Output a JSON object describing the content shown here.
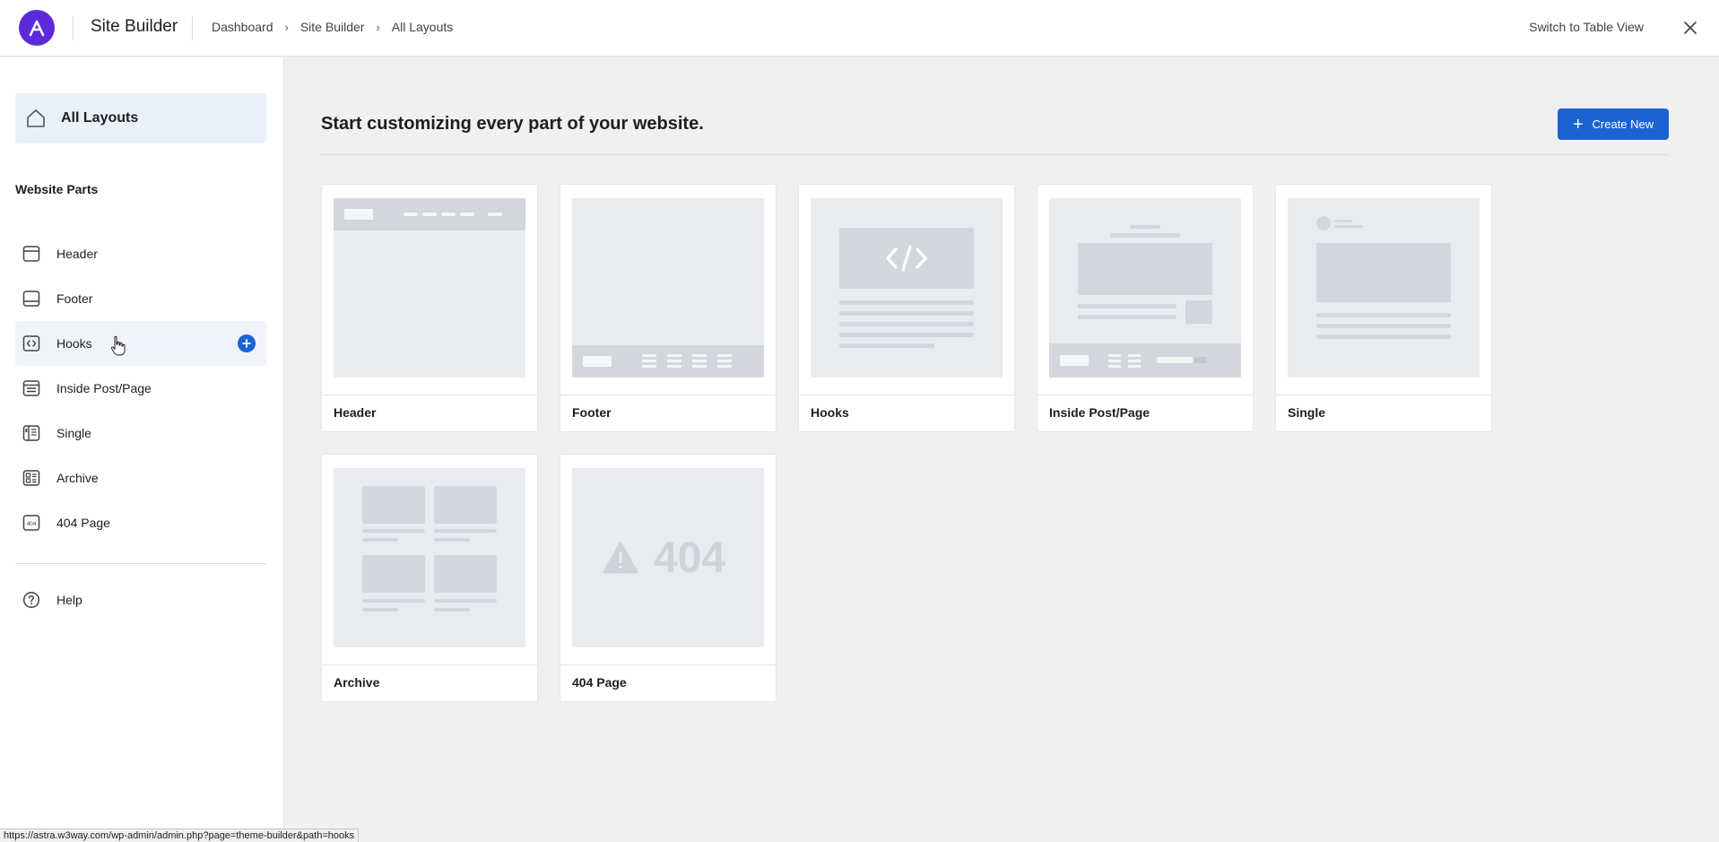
{
  "topbar": {
    "app_title": "Site Builder",
    "breadcrumb": [
      "Dashboard",
      "Site Builder",
      "All Layouts"
    ],
    "switch_view_label": "Switch to Table View"
  },
  "sidebar": {
    "all_layouts_label": "All Layouts",
    "section_title": "Website Parts",
    "items": [
      {
        "label": "Header",
        "icon": "header-icon"
      },
      {
        "label": "Footer",
        "icon": "footer-icon"
      },
      {
        "label": "Hooks",
        "icon": "code-icon"
      },
      {
        "label": "Inside Post/Page",
        "icon": "inside-post-icon"
      },
      {
        "label": "Single",
        "icon": "single-icon"
      },
      {
        "label": "Archive",
        "icon": "archive-icon"
      },
      {
        "label": "404 Page",
        "icon": "404-icon"
      }
    ],
    "help_label": "Help"
  },
  "main": {
    "heading": "Start customizing every part of your website.",
    "create_label": "Create New",
    "cards": [
      {
        "label": "Header"
      },
      {
        "label": "Footer"
      },
      {
        "label": "Hooks"
      },
      {
        "label": "Inside Post/Page"
      },
      {
        "label": "Single"
      },
      {
        "label": "Archive"
      },
      {
        "label": "404 Page"
      }
    ],
    "thumb_404_text": "404"
  },
  "statusbar": {
    "url": "https://astra.w3way.com/wp-admin/admin.php?page=theme-builder&path=hooks"
  },
  "colors": {
    "accent": "#1a63d1",
    "brand": "#5b2bd9",
    "active_bg": "#e9f1fb"
  }
}
